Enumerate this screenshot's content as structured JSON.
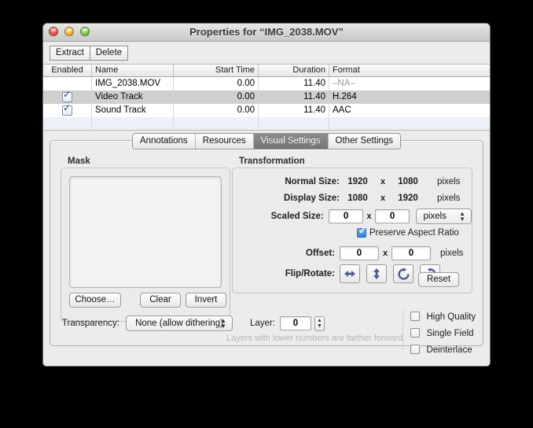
{
  "window": {
    "title": "Properties for “IMG_2038.MOV”",
    "traffic_lights": [
      "close",
      "minimize",
      "zoom"
    ]
  },
  "toolbar": {
    "extract_label": "Extract",
    "delete_label": "Delete"
  },
  "table": {
    "columns": [
      "Enabled",
      "Name",
      "Start Time",
      "Duration",
      "Format"
    ],
    "rows": [
      {
        "enabled": "",
        "checked": false,
        "name": "IMG_2038.MOV",
        "start": "0.00",
        "duration": "11.40",
        "format": "–NA–",
        "format_na": true,
        "selected": false
      },
      {
        "enabled": "",
        "checked": true,
        "name": "Video Track",
        "start": "0.00",
        "duration": "11.40",
        "format": "H.264",
        "format_na": false,
        "selected": true
      },
      {
        "enabled": "",
        "checked": true,
        "name": "Sound Track",
        "start": "0.00",
        "duration": "11.40",
        "format": "AAC",
        "format_na": false,
        "selected": false
      }
    ]
  },
  "tabs": {
    "items": [
      "Annotations",
      "Resources",
      "Visual Settings",
      "Other Settings"
    ],
    "active": "Visual Settings"
  },
  "mask": {
    "group_label": "Mask",
    "choose_label": "Choose…",
    "clear_label": "Clear",
    "invert_label": "Invert"
  },
  "transformation": {
    "group_label": "Transformation",
    "normal_size": {
      "label": "Normal Size:",
      "width": "1920",
      "x": "x",
      "height": "1080",
      "unit": "pixels"
    },
    "display_size": {
      "label": "Display Size:",
      "width": "1080",
      "x": "x",
      "height": "1920",
      "unit": "pixels"
    },
    "scaled_size": {
      "label": "Scaled Size:",
      "width": "0",
      "x": "x",
      "height": "0",
      "unit_selected": "pixels"
    },
    "preserve_aspect": {
      "label": "Preserve Aspect Ratio",
      "checked": true
    },
    "offset": {
      "label": "Offset:",
      "x_value": "0",
      "x": "x",
      "y_value": "0",
      "unit": "pixels"
    },
    "flip_rotate": {
      "label": "Flip/Rotate:",
      "buttons": [
        "flip-horizontal-icon",
        "flip-vertical-icon",
        "rotate-clockwise-icon",
        "rotate-counterclockwise-icon"
      ]
    },
    "reset_label": "Reset"
  },
  "footer": {
    "transparency_label": "Transparency:",
    "transparency_value": "None (allow dithering)",
    "layer_label": "Layer:",
    "layer_value": "0",
    "hint": "Layers with lower numbers are farther forward.",
    "options": [
      {
        "label": "High Quality",
        "checked": false
      },
      {
        "label": "Single Field",
        "checked": false
      },
      {
        "label": "Deinterlace",
        "checked": false
      }
    ]
  },
  "colors": {
    "window_bg": "#ececec",
    "selected_row": "#cfcfcf",
    "active_tab": "#7d7d7d",
    "accent_checkbox": "#2f7fd8",
    "icon_blue": "#4f5b8f"
  }
}
